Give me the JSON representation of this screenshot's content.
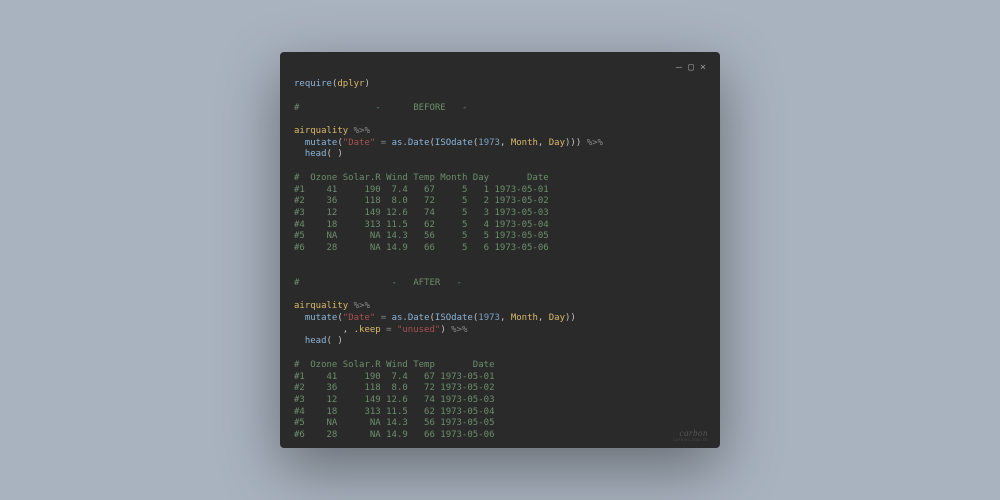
{
  "window": {
    "minimize": "—",
    "maximize": "▢",
    "close": "×"
  },
  "code": {
    "l1_require": "require",
    "l1_open": "(",
    "l1_pkg": "dplyr",
    "l1_close": ")",
    "l2_before": "#              -      BEFORE   -",
    "l3_aq": "airquality",
    "l3_pipe": " %>%",
    "l4_indent": "  ",
    "l4_mutate": "mutate",
    "l4_open": "(",
    "l4_date_str": "\"Date\"",
    "l4_eq": " = ",
    "l4_asdate": "as.Date",
    "l4_open2": "(",
    "l4_iso": "ISOdate",
    "l4_open3": "(",
    "l4_1973": "1973",
    "l4_c1": ", ",
    "l4_month": "Month",
    "l4_c2": ", ",
    "l4_day": "Day",
    "l4_close": ")))",
    "l4_pipe": " %>%",
    "l5_indent": "  ",
    "l5_head": "head",
    "l5_parens": "( )",
    "tbl1_hdr": "#  Ozone Solar.R Wind Temp Month Day       Date",
    "tbl1_r1": "#1    41     190  7.4   67     5   1 1973-05-01",
    "tbl1_r2": "#2    36     118  8.0   72     5   2 1973-05-02",
    "tbl1_r3": "#3    12     149 12.6   74     5   3 1973-05-03",
    "tbl1_r4": "#4    18     313 11.5   62     5   4 1973-05-04",
    "tbl1_r5": "#5    NA      NA 14.3   56     5   5 1973-05-05",
    "tbl1_r6": "#6    28      NA 14.9   66     5   6 1973-05-06",
    "l_after": "#                 -   AFTER   -",
    "b3_aq": "airquality",
    "b3_pipe": " %>%",
    "b4_indent": "  ",
    "b4_mutate": "mutate",
    "b4_open": "(",
    "b4_date_str": "\"Date\"",
    "b4_eq": " = ",
    "b4_asdate": "as.Date",
    "b4_open2": "(",
    "b4_iso": "ISOdate",
    "b4_open3": "(",
    "b4_1973": "1973",
    "b4_c1": ", ",
    "b4_month": "Month",
    "b4_c2": ", ",
    "b4_day": "Day",
    "b4_close": "))",
    "b5_indent": "         , ",
    "b5_keep": ".keep",
    "b5_eq": " = ",
    "b5_unused": "\"unused\"",
    "b5_close": ")",
    "b5_pipe": " %>%",
    "b6_indent": "  ",
    "b6_head": "head",
    "b6_parens": "( )",
    "tbl2_hdr": "#  Ozone Solar.R Wind Temp       Date",
    "tbl2_r1": "#1    41     190  7.4   67 1973-05-01",
    "tbl2_r2": "#2    36     118  8.0   72 1973-05-02",
    "tbl2_r3": "#3    12     149 12.6   74 1973-05-03",
    "tbl2_r4": "#4    18     313 11.5   62 1973-05-04",
    "tbl2_r5": "#5    NA      NA 14.3   56 1973-05-05",
    "tbl2_r6": "#6    28      NA 14.9   66 1973-05-06"
  },
  "watermark": {
    "brand": "carbon",
    "sub": "carbon.now.sh"
  }
}
